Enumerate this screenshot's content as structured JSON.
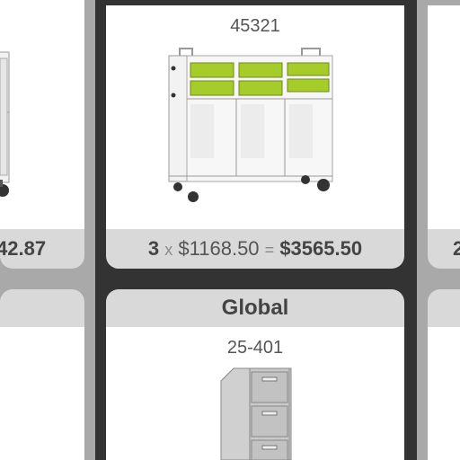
{
  "products": {
    "left_top": {
      "price_fragment": "42.87"
    },
    "center_top": {
      "sku": "45321",
      "qty": "3",
      "times": "x",
      "unit_price": "$1168.50",
      "equals": "=",
      "total": "$3565.50"
    },
    "right_top": {
      "fragment": "2"
    },
    "center_bottom": {
      "brand": "Global",
      "sku": "25-401"
    }
  },
  "colors": {
    "tray": "#a6cc2a",
    "cart": "#f2f2f2",
    "cabinet": "#c8c8c8",
    "footer": "#d9d9d9"
  }
}
